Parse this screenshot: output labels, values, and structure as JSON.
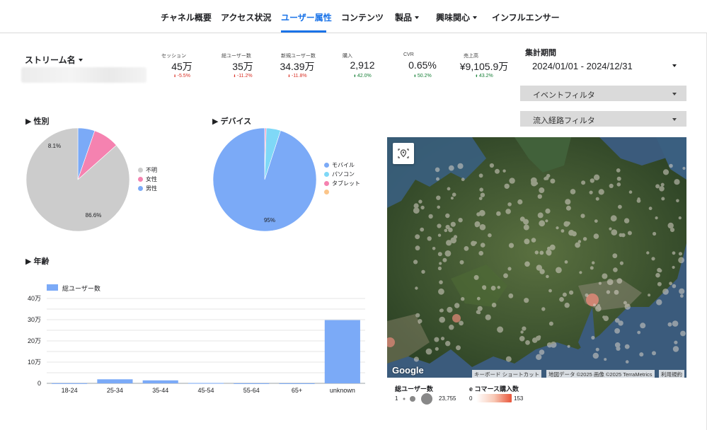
{
  "nav": {
    "tabs": [
      {
        "label": "チャネル概要",
        "active": false,
        "dropdown": false
      },
      {
        "label": "アクセス状況",
        "active": false,
        "dropdown": false
      },
      {
        "label": "ユーザー属性",
        "active": true,
        "dropdown": false
      },
      {
        "label": "コンテンツ",
        "active": false,
        "dropdown": false
      },
      {
        "label": "製品",
        "active": false,
        "dropdown": true
      },
      {
        "label": "興味関心",
        "active": false,
        "dropdown": true
      },
      {
        "label": "インフルエンサー",
        "active": false,
        "dropdown": false
      }
    ]
  },
  "stream": {
    "label": "ストリーム名"
  },
  "kpis": [
    {
      "label": "セッション",
      "value": "45万",
      "delta": "-5.5%",
      "direction": "down"
    },
    {
      "label": "総ユーザー数",
      "value": "35万",
      "delta": "-11.2%",
      "direction": "down"
    },
    {
      "label": "新規ユーザー数",
      "value": "34.39万",
      "delta": "-11.8%",
      "direction": "down"
    },
    {
      "label": "購入",
      "value": "2,912",
      "delta": "42.0%",
      "direction": "up"
    },
    {
      "label": "CVR",
      "value": "0.65%",
      "delta": "50.2%",
      "direction": "up"
    },
    {
      "label": "売上高",
      "value": "¥9,105.9万",
      "delta": "43.2%",
      "direction": "up"
    }
  ],
  "period": {
    "label": "集計期間",
    "value": "2024/01/01 - 2024/12/31"
  },
  "filters": {
    "event": "イベントフィルタ",
    "source": "流入経路フィルタ"
  },
  "sections": {
    "gender": "▶ 性別",
    "device": "▶ デバイス",
    "age": "▶ 年齢"
  },
  "colors": {
    "accent": "#1a73e8",
    "unknown": "#cccccc",
    "female": "#f582b0",
    "male": "#7baaf7",
    "mobile": "#7baaf7",
    "pc": "#7fd8f7",
    "tablet": "#f582b0",
    "other": "#fbc58a",
    "down": "#d93025",
    "up": "#188038"
  },
  "chart_data": [
    {
      "type": "pie",
      "title": "性別",
      "labels": [
        "不明",
        "女性",
        "男性"
      ],
      "values": [
        86.6,
        8.1,
        5.3
      ],
      "data_labels": [
        "86.6%",
        "8.1%",
        ""
      ]
    },
    {
      "type": "pie",
      "title": "デバイス",
      "labels": [
        "モバイル",
        "パソコン",
        "タブレット",
        ""
      ],
      "values": [
        95,
        4.5,
        0.4,
        0.1
      ],
      "data_labels": [
        "95%",
        "",
        "",
        ""
      ]
    },
    {
      "type": "bar",
      "title": "年齢",
      "categories": [
        "18-24",
        "25-34",
        "35-44",
        "45-54",
        "55-64",
        "65+",
        "unknown"
      ],
      "series": [
        {
          "name": "総ユーザー数",
          "values": [
            400,
            19000,
            14000,
            1500,
            200,
            100,
            298000
          ]
        }
      ],
      "ylim": [
        0,
        400000
      ],
      "yticks": [
        0,
        100000,
        200000,
        300000,
        400000
      ],
      "yticklabels": [
        "0",
        "10万",
        "20万",
        "30万",
        "40万"
      ]
    }
  ],
  "map": {
    "logo": "Google",
    "attribution": [
      "キーボード ショートカット",
      "地図データ ©2025 画像 ©2025 TerraMetrics",
      "利用規約"
    ],
    "legend_users": {
      "title": "総ユーザー数",
      "min": "1",
      "max": "23,755"
    },
    "legend_ecommerce": {
      "title": "e コマース購入数",
      "min": "0",
      "max": "153"
    }
  }
}
